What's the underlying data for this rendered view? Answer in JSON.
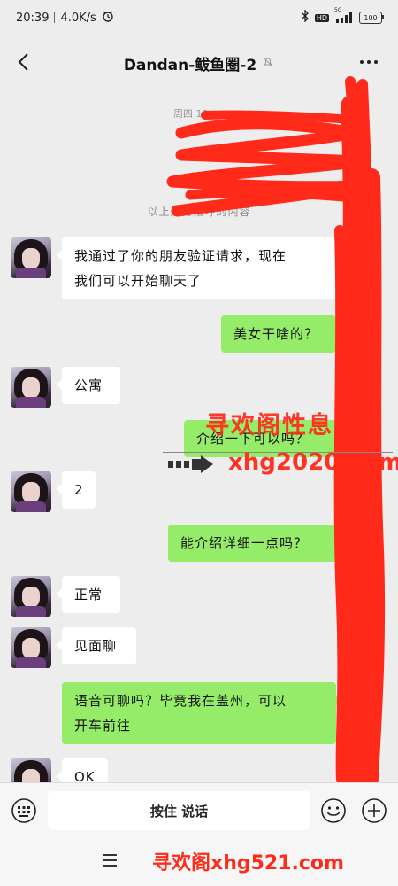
{
  "status_bar": {
    "time": "20:39",
    "network_speed": "4.0K/s",
    "hd_label": "HD",
    "signal_label": "5G",
    "battery": "100"
  },
  "header": {
    "title": "Dandan-鲅鱼圈-2"
  },
  "chat": {
    "time_label": "周四 13:",
    "system_message": "以上是打招呼的内容",
    "messages": [
      {
        "side": "in",
        "text_lines": [
          "我通过了你的朋友验证请求，现在",
          "我们可以开始聊天了"
        ]
      },
      {
        "side": "out",
        "text_lines": [
          "美女干啥的？"
        ]
      },
      {
        "side": "in",
        "text_lines": [
          "公寓"
        ]
      },
      {
        "side": "out",
        "text_lines": [
          "介绍一下可以吗？"
        ]
      },
      {
        "side": "in",
        "text_lines": [
          "2"
        ]
      },
      {
        "side": "out",
        "text_lines": [
          "能介绍详细一点吗？"
        ]
      },
      {
        "side": "in",
        "text_lines": [
          "正常"
        ]
      },
      {
        "side": "in",
        "text_lines": [
          "见面聊"
        ]
      },
      {
        "side": "out",
        "text_lines": [
          "语音可聊吗？毕竟我在盖州，可以",
          "开车前往"
        ]
      },
      {
        "side": "in",
        "text_lines": [
          "OK"
        ]
      }
    ]
  },
  "input_bar": {
    "hold_to_talk": "按住 说话"
  },
  "watermarks": {
    "top_text": "寻欢阁性息网",
    "top_url": "xhg2020.com",
    "bottom_text": "寻欢阁xhg521.com"
  },
  "colors": {
    "out_bubble": "#95ec69",
    "in_bubble": "#ffffff",
    "background": "#ededed",
    "scribble": "#ff2a1a"
  },
  "icons": {
    "back": "chevron-left-icon",
    "mute": "bell-off-icon",
    "more": "more-dots-icon",
    "keyboard": "keyboard-icon",
    "emoji": "emoji-icon",
    "plus": "plus-circle-icon",
    "menu": "menu-lines-icon"
  }
}
